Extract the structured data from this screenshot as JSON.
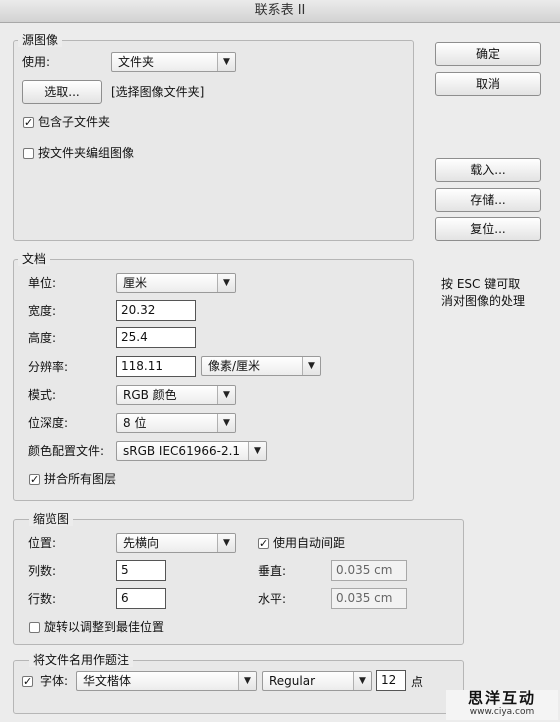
{
  "window": {
    "title": "联系表 II"
  },
  "source": {
    "legend": "源图像",
    "use_label": "使用:",
    "use_value": "文件夹",
    "choose_button": "选取...",
    "choose_hint": "[选择图像文件夹]",
    "include_subfolders": {
      "label": "包含子文件夹",
      "checked": true
    },
    "group_by_folder": {
      "label": "按文件夹编组图像",
      "checked": false
    }
  },
  "side_buttons": {
    "ok": "确定",
    "cancel": "取消",
    "load": "载入...",
    "save": "存储...",
    "reset": "复位..."
  },
  "hint_text": {
    "line1": "按 ESC 键可取",
    "line2": "消对图像的处理"
  },
  "document": {
    "legend": "文档",
    "unit_label": "单位:",
    "unit_value": "厘米",
    "width_label": "宽度:",
    "width_value": "20.32",
    "height_label": "高度:",
    "height_value": "25.4",
    "resolution_label": "分辨率:",
    "resolution_value": "118.11",
    "resolution_unit": "像素/厘米",
    "mode_label": "模式:",
    "mode_value": "RGB 颜色",
    "depth_label": "位深度:",
    "depth_value": "8 位",
    "profile_label": "颜色配置文件:",
    "profile_value": "sRGB IEC61966-2.1",
    "flatten": {
      "label": "拼合所有图层",
      "checked": true
    }
  },
  "thumbnails": {
    "legend": "缩览图",
    "place_label": "位置:",
    "place_value": "先横向",
    "auto_spacing": {
      "label": "使用自动间距",
      "checked": true
    },
    "columns_label": "列数:",
    "columns_value": "5",
    "rows_label": "行数:",
    "rows_value": "6",
    "vertical_label": "垂直:",
    "vertical_value": "0.035 cm",
    "horizontal_label": "水平:",
    "horizontal_value": "0.035 cm",
    "rotate": {
      "label": "旋转以调整到最佳位置",
      "checked": false
    }
  },
  "caption": {
    "legend": "将文件名用作题注",
    "enabled": true,
    "font_label": "字体:",
    "font_value": "华文楷体",
    "style_value": "Regular",
    "size_value": "12",
    "size_unit": "点"
  },
  "watermark": {
    "main": "思洋互动",
    "sub": "www.ciya.com"
  }
}
